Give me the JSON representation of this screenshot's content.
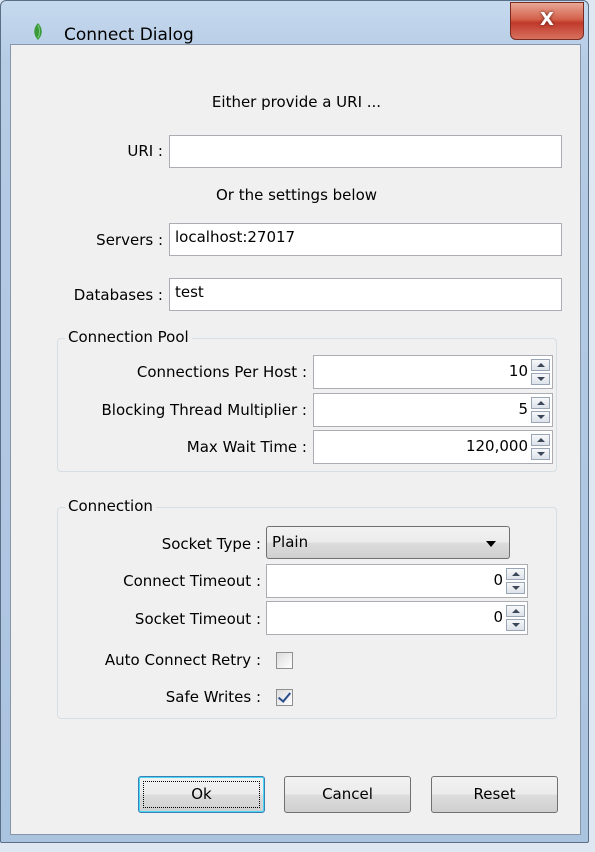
{
  "window": {
    "title": "Connect Dialog",
    "close_label": "X",
    "icon": "leaf-icon"
  },
  "intro": {
    "either_text": "Either provide a URI ...",
    "or_text": "Or the settings below"
  },
  "fields": {
    "uri_label": "URI :",
    "uri_value": "",
    "servers_label": "Servers :",
    "servers_value": "localhost:27017",
    "databases_label": "Databases :",
    "databases_value": "test"
  },
  "connection_pool": {
    "title": "Connection Pool",
    "per_host_label": "Connections Per Host :",
    "per_host_value": "10",
    "multiplier_label": "Blocking Thread Multiplier :",
    "multiplier_value": "5",
    "max_wait_label": "Max Wait Time :",
    "max_wait_value": "120,000"
  },
  "connection": {
    "title": "Connection",
    "socket_type_label": "Socket Type :",
    "socket_type_value": "Plain",
    "connect_timeout_label": "Connect Timeout :",
    "connect_timeout_value": "0",
    "socket_timeout_label": "Socket Timeout :",
    "socket_timeout_value": "0",
    "auto_retry_label": "Auto Connect Retry :",
    "auto_retry_checked": false,
    "safe_writes_label": "Safe Writes :",
    "safe_writes_checked": true
  },
  "buttons": {
    "ok": "Ok",
    "cancel": "Cancel",
    "reset": "Reset"
  }
}
